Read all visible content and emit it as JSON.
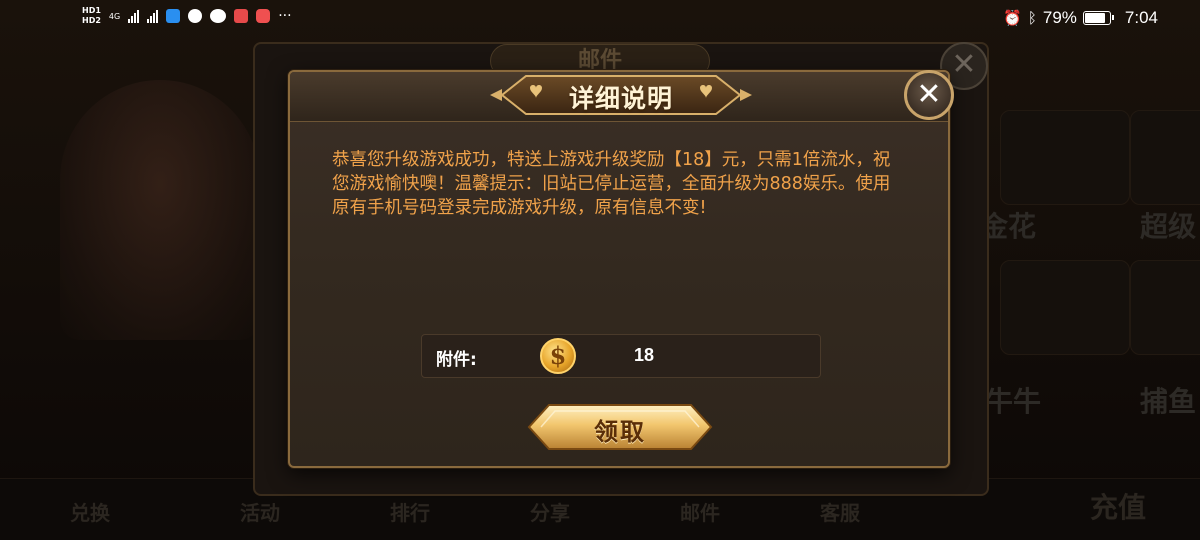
{
  "status_bar": {
    "battery_percent": "79%",
    "battery_level": 0.79,
    "time": "7:04",
    "network": "4G",
    "more": "···"
  },
  "background": {
    "mail_panel_title": "邮件",
    "bottom_tabs": [
      "兑换",
      "活动",
      "排行",
      "分享",
      "邮件",
      "客服",
      "充值"
    ],
    "side_cards": [
      "金花",
      "超级",
      "牛牛",
      "捕鱼"
    ]
  },
  "dialog": {
    "title": "详细说明",
    "message": "恭喜您升级游戏成功，特送上游戏升级奖励【18】元，只需1倍流水，祝您游戏愉快噢！温馨提示：旧站已停止运营，全面升级为888娱乐。使用原有手机号码登录完成游戏升级，原有信息不变!",
    "attachment_label": "附件:",
    "attachment_value": "18",
    "claim_button": "领取",
    "close_symbol": "✕"
  },
  "colors": {
    "accent_gold": "#c9a46a",
    "message_text": "#f0a24a",
    "dialog_bg": "#33291f"
  }
}
